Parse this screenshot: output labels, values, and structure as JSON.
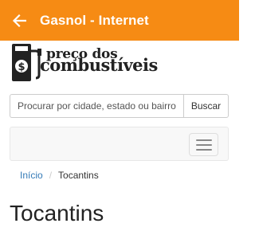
{
  "appbar": {
    "title": "Gasnol - Internet",
    "back_icon": "arrow-back-icon",
    "background": "#f68b14"
  },
  "logo": {
    "line1": "preço dos",
    "line2": "combustíveis",
    "icon": "fuel-pump-icon"
  },
  "search": {
    "placeholder": "Procurar por cidade, estado ou bairro",
    "button_label": "Buscar"
  },
  "navbar": {
    "toggle_icon": "hamburger-menu-icon"
  },
  "breadcrumb": {
    "items": [
      {
        "label": "Início"
      },
      {
        "label": "Tocantins"
      }
    ],
    "separator": "/"
  },
  "page": {
    "title": "Tocantins"
  },
  "colors": {
    "accent": "#f68b14",
    "link": "#337ab7"
  }
}
